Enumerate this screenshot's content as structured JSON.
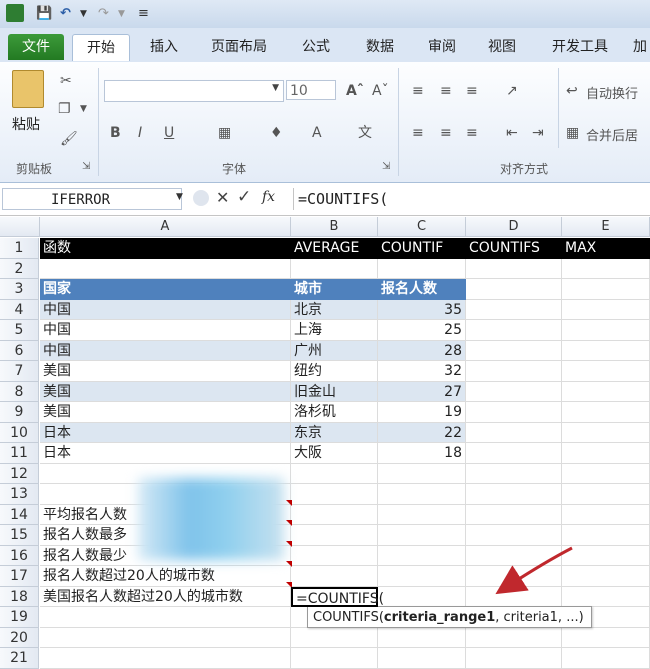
{
  "ribbon_tabs": [
    "文件",
    "开始",
    "插入",
    "页面布局",
    "公式",
    "数据",
    "审阅",
    "视图",
    "开发工具",
    "加"
  ],
  "ribbon": {
    "paste_label": "粘贴",
    "font_size": "10",
    "group_clipboard": "剪贴板",
    "group_font": "字体",
    "group_alignment": "对齐方式",
    "wrap_text": "自动换行",
    "merge_center": "合并后居"
  },
  "formula_bar": {
    "name_box": "IFERROR",
    "fx": "fx",
    "formula": "=COUNTIFS("
  },
  "columns": [
    "A",
    "B",
    "C",
    "D",
    "E"
  ],
  "rows": [
    "1",
    "2",
    "3",
    "4",
    "5",
    "6",
    "7",
    "8",
    "9",
    "10",
    "11",
    "12",
    "13",
    "14",
    "15",
    "16",
    "17",
    "18",
    "19",
    "20",
    "21"
  ],
  "sheet": {
    "r1": {
      "a": "函数",
      "b": "AVERAGE",
      "c": "COUNTIF",
      "d": "COUNTIFS",
      "e": "MAX"
    },
    "table_header": {
      "country": "国家",
      "city": "城市",
      "count": "报名人数"
    },
    "table_rows": [
      {
        "country": "中国",
        "city": "北京",
        "count": "35"
      },
      {
        "country": "中国",
        "city": "上海",
        "count": "25"
      },
      {
        "country": "中国",
        "city": "广州",
        "count": "28"
      },
      {
        "country": "美国",
        "city": "纽约",
        "count": "32"
      },
      {
        "country": "美国",
        "city": "旧金山",
        "count": "27"
      },
      {
        "country": "美国",
        "city": "洛杉矶",
        "count": "19"
      },
      {
        "country": "日本",
        "city": "东京",
        "count": "22"
      },
      {
        "country": "日本",
        "city": "大阪",
        "count": "18"
      }
    ],
    "questions": [
      "平均报名人数",
      "报名人数最多",
      "报名人数最少",
      "报名人数超过20人的城市数",
      "美国报名人数超过20人的城市数"
    ],
    "active_cell_value": "=COUNTIFS("
  },
  "tooltip": {
    "func": "COUNTIFS(",
    "arg1": "criteria_range1",
    ", rest": ", criteria1, ...)"
  },
  "colors": {
    "header_blue": "#4f81bd",
    "band": "#dce6f1",
    "black_header": "#000000",
    "arrow_red": "#c0282d"
  }
}
